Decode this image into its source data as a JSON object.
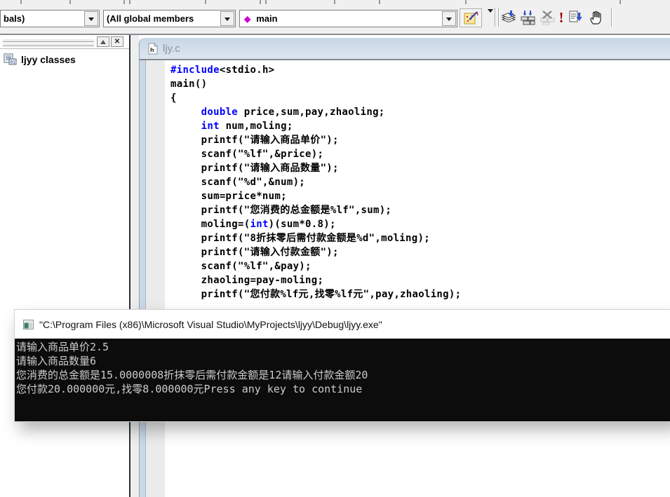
{
  "toolbar": {
    "globals_combo": "bals)",
    "members_combo": "(All global members",
    "function_combo": "main",
    "icon_names": [
      "wizardbar-actions-icon",
      "compile-icon",
      "build-icon",
      "stop-build-icon",
      "execute-program-icon",
      "go-icon",
      "breakpoint-hand-icon"
    ]
  },
  "workspace": {
    "root_label": "ljyy classes"
  },
  "editor": {
    "title": "ljy.c",
    "code_lines": [
      [
        {
          "t": "#include",
          "c": "kw"
        },
        {
          "t": "<stdio.h>",
          "c": "pl"
        }
      ],
      [
        {
          "t": "main()",
          "c": "pl"
        }
      ],
      [
        {
          "t": "{",
          "c": "pl"
        }
      ],
      [
        {
          "t": "     ",
          "c": "pl"
        },
        {
          "t": "double",
          "c": "kw"
        },
        {
          "t": " price,sum,pay,zhaoling;",
          "c": "pl"
        }
      ],
      [
        {
          "t": "     ",
          "c": "pl"
        },
        {
          "t": "int",
          "c": "kw"
        },
        {
          "t": " num,moling;",
          "c": "pl"
        }
      ],
      [
        {
          "t": "     printf(\"请输入商品单价\");",
          "c": "pl"
        }
      ],
      [
        {
          "t": "     scanf(\"%lf\",&price);",
          "c": "pl"
        }
      ],
      [
        {
          "t": "     printf(\"请输入商品数量\");",
          "c": "pl"
        }
      ],
      [
        {
          "t": "     scanf(\"%d\",&num);",
          "c": "pl"
        }
      ],
      [
        {
          "t": "     sum=price*num;",
          "c": "pl"
        }
      ],
      [
        {
          "t": "     printf(\"您消费的总金额是%lf\",sum);",
          "c": "pl"
        }
      ],
      [
        {
          "t": "     moling=(",
          "c": "pl"
        },
        {
          "t": "int",
          "c": "kw"
        },
        {
          "t": ")(sum*0.8);",
          "c": "pl"
        }
      ],
      [
        {
          "t": "     printf(\"8折抹零后需付款金额是%d\",moling);",
          "c": "pl"
        }
      ],
      [
        {
          "t": "     printf(\"请输入付款金额\");",
          "c": "pl"
        }
      ],
      [
        {
          "t": "     scanf(\"%lf\",&pay);",
          "c": "pl"
        }
      ],
      [
        {
          "t": "     zhaoling=pay-moling;",
          "c": "pl"
        }
      ],
      [
        {
          "t": "     printf(\"您付款%lf元,找零%lf元\",pay,zhaoling);",
          "c": "pl"
        }
      ]
    ]
  },
  "console": {
    "title": "\"C:\\Program Files (x86)\\Microsoft Visual Studio\\MyProjects\\ljyy\\Debug\\ljyy.exe\"",
    "lines": [
      "请输入商品单价2.5",
      "请输入商品数量6",
      "您消费的总金额是15.0000008折抹零后需付款金额是12请输入付款金额20",
      "您付款20.000000元,找零8.000000元Press any key to continue"
    ]
  },
  "colors": {
    "keyword": "#0000ff",
    "console_bg": "#0c0c0c",
    "console_fg": "#cccccc",
    "titlebar_top": "#c7d6e6",
    "titlebar_bottom": "#dde6ef",
    "diamond_accent": "#d000d0",
    "execute_red": "#a40000"
  }
}
